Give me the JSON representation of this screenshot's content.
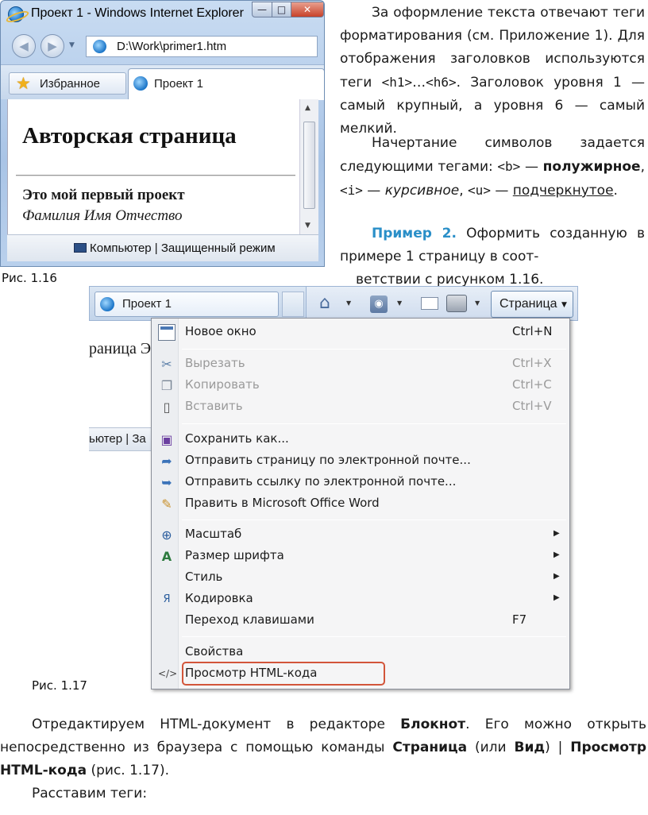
{
  "fig116": {
    "window_title": "Проект 1 - Windows Internet Explorer",
    "minimize": "—",
    "maximize": "□",
    "close": "✕",
    "back_glyph": "◀",
    "forward_glyph": "▶",
    "nav_dropdown": "▼",
    "address": "D:\\Work\\primer1.htm",
    "favorites_label": "Избранное",
    "tab_label": "Проект 1",
    "page_h1": "Авторская страница",
    "page_h3": "Это мой первый проект",
    "page_name": "Фамилия Имя Отчество",
    "status_text": "Компьютер | Защищенный режим",
    "caption": "Рис. 1.16"
  },
  "right_text": {
    "p1_a": "За оформление текста отвечают теги форматирования (см. Приложение 1). Для отображения заголовков используются теги ",
    "p1_tag1": "<h1>",
    "p1_dots": "…",
    "p1_tag2": "<h6>",
    "p1_b": ". Заголовок уровня 1 — самый крупный, а уровня 6 — самый мелкий.",
    "p2_a": "Начертание символов задается следующими тегами: ",
    "p2_tag_b": "<b>",
    "p2_dash": " — ",
    "p2_bold": "полужирное",
    "p2_comma": ", ",
    "p2_tag_i": "<i>",
    "p2_italic": "курсивное",
    "p2_tag_u": "<u>",
    "p2_under": "подчеркнутое",
    "p2_end": ".",
    "p3_example": "Пример 2.",
    "p3_text": " Оформить созданную в примере 1 страницу в соот-",
    "p3_cont": "ветствии с рисунком 1.16."
  },
  "fig117": {
    "tab_label": "Проект 1",
    "page_menu_label": "Страница",
    "bg_doc_text": "раница Э",
    "bg_status_text": "ьютер | За",
    "caption": "Рис. 1.17",
    "menu": {
      "new_window": {
        "label": "Новое окно",
        "shortcut": "Ctrl+N"
      },
      "cut": {
        "label": "Вырезать",
        "shortcut": "Ctrl+X"
      },
      "copy": {
        "label": "Копировать",
        "shortcut": "Ctrl+C"
      },
      "paste": {
        "label": "Вставить",
        "shortcut": "Ctrl+V"
      },
      "save_as": {
        "label": "Сохранить как..."
      },
      "send_page": {
        "label": "Отправить страницу по электронной почте..."
      },
      "send_link": {
        "label": "Отправить ссылку по электронной почте..."
      },
      "edit_word": {
        "label": "Править в Microsoft Office Word"
      },
      "zoom": {
        "label": "Масштаб"
      },
      "text_size": {
        "label": "Размер шрифта"
      },
      "style": {
        "label": "Стиль"
      },
      "encoding": {
        "label": "Кодировка"
      },
      "caret": {
        "label": "Переход клавишами",
        "shortcut": "F7"
      },
      "properties": {
        "label": "Свойства"
      },
      "view_source": {
        "label": "Просмотр HTML-кода"
      }
    },
    "highlight_color": "#d2553a"
  },
  "bottom": {
    "p1_a": "Отредактируем HTML-документ в редакторе ",
    "p1_b1": "Блокнот",
    "p1_c": ". Его можно открыть непосредственно из браузера с помощью команды ",
    "p1_b2": "Страница",
    "p1_d": " (или ",
    "p1_b3": "Вид",
    "p1_e": ") | ",
    "p1_b4": "Просмотр HTML-кода",
    "p1_f": " (рис. 1.17).",
    "p2": "Расставим теги:"
  },
  "colors": {
    "example_accent": "#2a8fc8",
    "menu_highlight": "#d2553a"
  }
}
